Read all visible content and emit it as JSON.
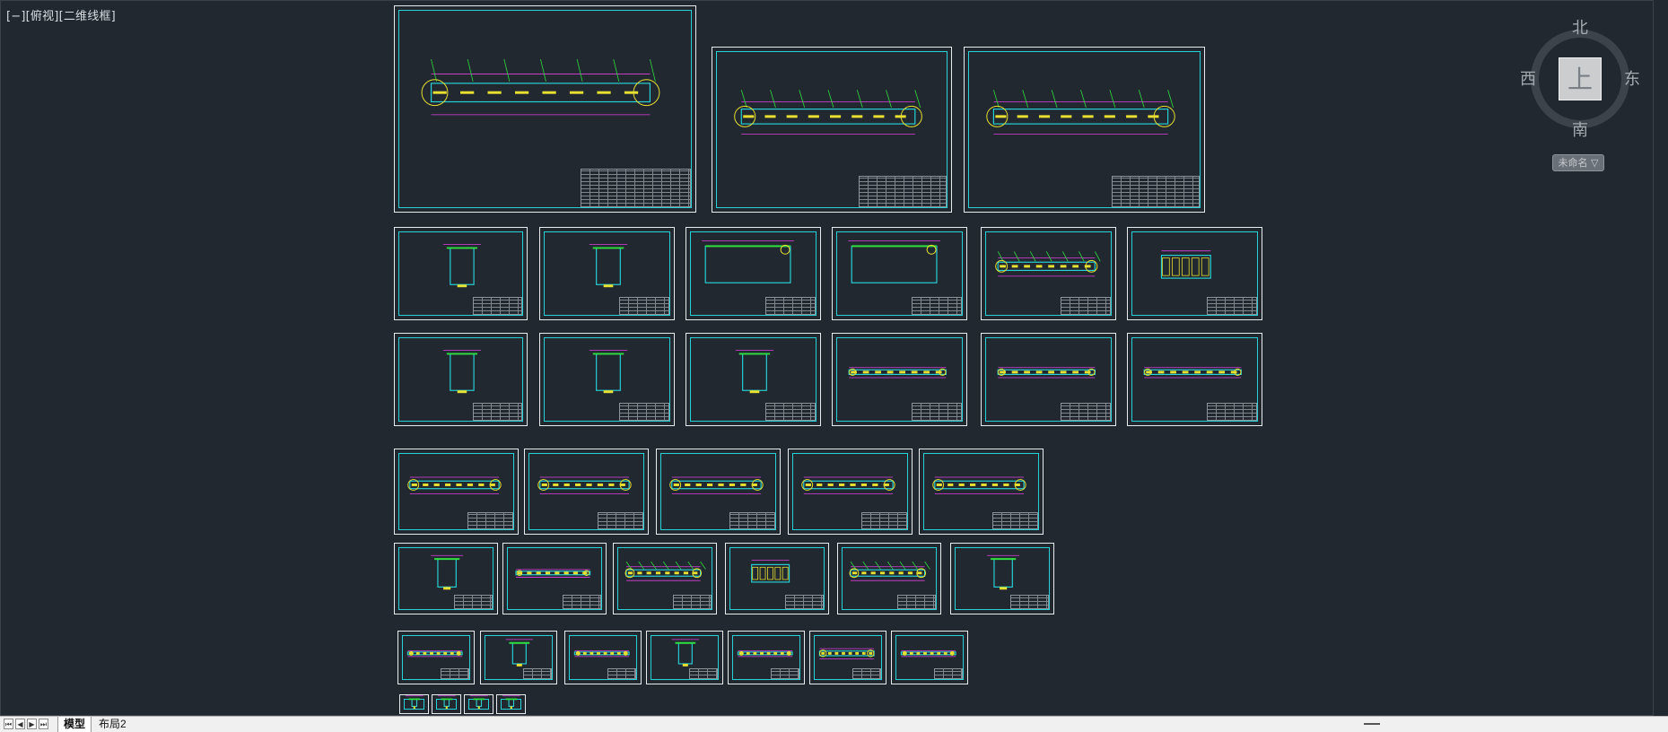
{
  "viewport": {
    "label": "[−][俯视][二维线框]",
    "background": "#212830"
  },
  "viewcube": {
    "north": "北",
    "south": "南",
    "west": "西",
    "east": "东",
    "face": "上",
    "ucs_menu": "未命名 ▽"
  },
  "colors": {
    "sheet_border": "#e8ecef",
    "frame": "#27d1d6",
    "dim_magenta": "#e040e0",
    "part_yellow": "#e8e030",
    "line_green": "#30e040"
  },
  "tabs": {
    "model": "模型",
    "layout2": "布局2"
  }
}
